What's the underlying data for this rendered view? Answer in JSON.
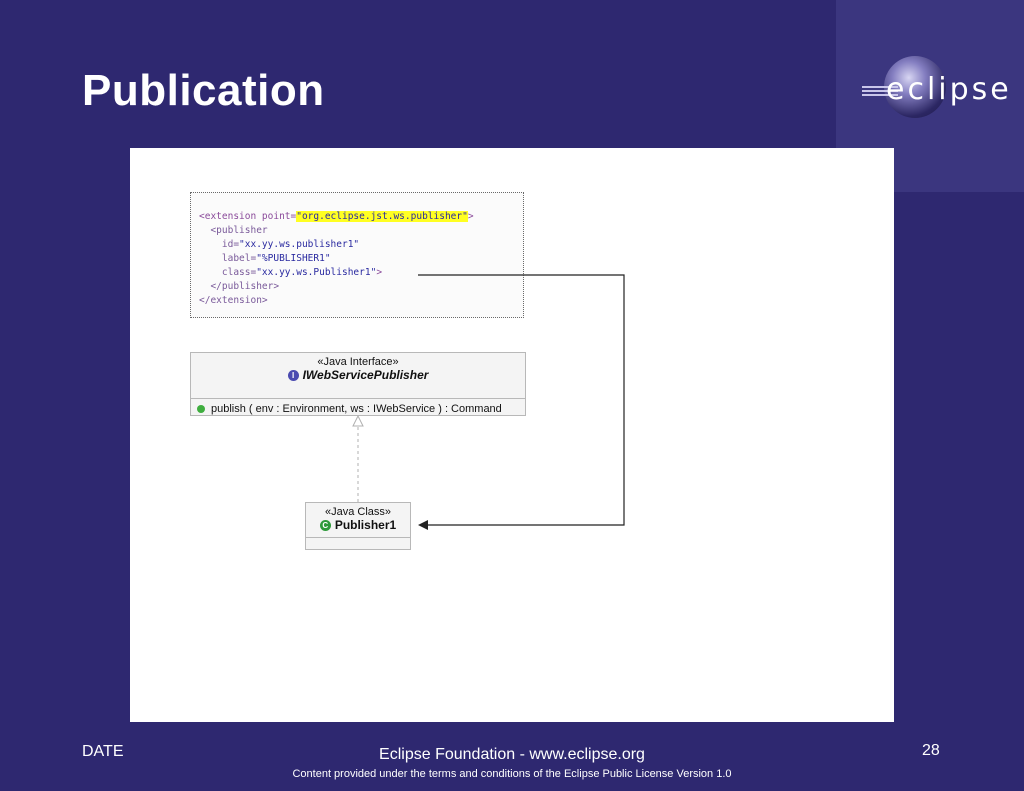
{
  "slide": {
    "title": "Publication",
    "logo_text": "eclipse",
    "footer": {
      "date": "DATE",
      "center": "Eclipse Foundation - www.eclipse.org",
      "license": "Content provided under the terms and conditions of the Eclipse Public License Version 1.0",
      "page_number": "28"
    }
  },
  "xml": {
    "line1_open": "<extension point=",
    "line1_value": "\"org.eclipse.jst.ws.publisher\"",
    "line1_close": ">",
    "line2": "  <publisher",
    "line3_attr": "    id=",
    "line3_value": "\"xx.yy.ws.publisher1\"",
    "line4_attr": "    label=",
    "line4_value": "\"%PUBLISHER1\"",
    "line5_attr": "    class=",
    "line5_value": "\"xx.yy.ws.Publisher1\"",
    "line5_close": ">",
    "line6": "  </publisher>",
    "line7": "</extension>"
  },
  "uml": {
    "interface": {
      "stereotype": "«Java Interface»",
      "badge": "I",
      "name": "IWebServicePublisher",
      "method": "publish ( env : Environment, ws : IWebService ) : Command"
    },
    "class": {
      "stereotype": "«Java Class»",
      "badge": "C",
      "name": "Publisher1"
    }
  },
  "colors": {
    "background": "#2e2870",
    "highlight": "#ffff22"
  }
}
